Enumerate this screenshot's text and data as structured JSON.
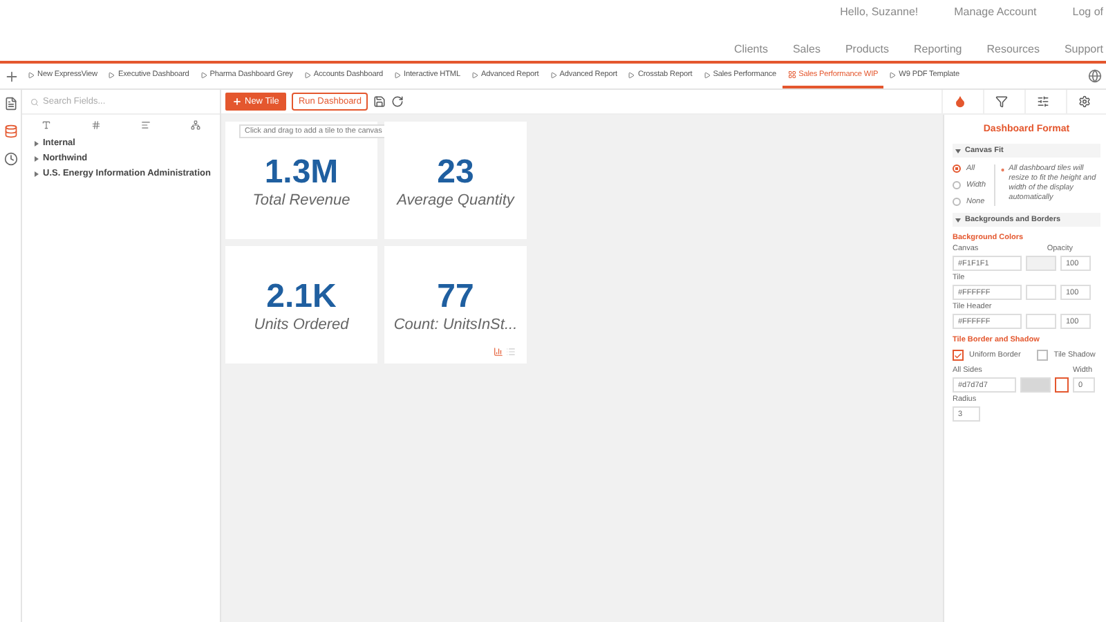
{
  "header": {
    "greeting": "Hello, Suzanne!",
    "links": [
      "Manage Account",
      "Log of"
    ]
  },
  "nav": [
    "Clients",
    "Sales",
    "Products",
    "Reporting",
    "Resources",
    "Support"
  ],
  "tabs": [
    {
      "label": "New ExpressView",
      "selected": false
    },
    {
      "label": "Executive Dashboard",
      "selected": false
    },
    {
      "label": "Pharma Dashboard Grey",
      "selected": false
    },
    {
      "label": "Accounts Dashboard",
      "selected": false
    },
    {
      "label": "Interactive HTML",
      "selected": false
    },
    {
      "label": "Advanced Report",
      "selected": false
    },
    {
      "label": "Advanced Report",
      "selected": false
    },
    {
      "label": "Crosstab Report",
      "selected": false
    },
    {
      "label": "Sales Performance",
      "selected": false
    },
    {
      "label": "Sales Performance WIP",
      "selected": true
    },
    {
      "label": "W9 PDF Template",
      "selected": false
    }
  ],
  "side_icons": [
    {
      "kind": "file",
      "selected": false
    },
    {
      "kind": "database",
      "selected": true
    },
    {
      "kind": "clock",
      "selected": false
    }
  ],
  "fields": {
    "search_placeholder": "Search Fields...",
    "tree": [
      "Internal",
      "Northwind",
      "U.S. Energy Information Administration"
    ]
  },
  "toolbar": {
    "new_tile": "New Tile",
    "run_dashboard": "Run Dashboard"
  },
  "canvas": {
    "hint": "Click and drag to add a tile to the canvas",
    "tiles": [
      {
        "value": "1.3M",
        "label": "Total Revenue"
      },
      {
        "value": "23",
        "label": "Average Quantity"
      },
      {
        "value": "2.1K",
        "label": "Units Ordered"
      },
      {
        "value": "77",
        "label": "Count: UnitsInSt..."
      }
    ]
  },
  "format_panel": {
    "title": "Dashboard Format",
    "canvas_fit": {
      "heading": "Canvas Fit",
      "options": [
        {
          "label": "All",
          "selected": true
        },
        {
          "label": "Width",
          "selected": false
        },
        {
          "label": "None",
          "selected": false
        }
      ],
      "note": "All dashboard tiles will resize to fit the height and width of the display automatically"
    },
    "backgrounds": {
      "heading": "Backgrounds and Borders",
      "colors_heading": "Background Colors",
      "opacity_label": "Opacity",
      "rows": [
        {
          "label": "Canvas",
          "value": "#F1F1F1",
          "opacity": "100"
        },
        {
          "label": "Tile",
          "value": "#FFFFFF",
          "opacity": "100"
        },
        {
          "label": "Tile Header",
          "value": "#FFFFFF",
          "opacity": "100"
        }
      ]
    },
    "border": {
      "heading": "Tile Border and Shadow",
      "uniform_border": {
        "label": "Uniform Border",
        "checked": true
      },
      "tile_shadow": {
        "label": "Tile Shadow",
        "checked": false
      },
      "all_sides_label": "All Sides",
      "all_sides_value": "#d7d7d7",
      "width_label": "Width",
      "width_value": "0",
      "radius_label": "Radius",
      "radius_value": "3"
    }
  }
}
